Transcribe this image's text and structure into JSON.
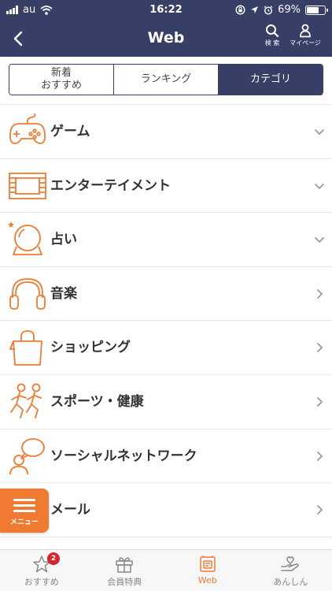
{
  "status_bar": {
    "carrier": "au",
    "time": "16:22",
    "battery": "69%",
    "battery_level": 0.69
  },
  "header": {
    "title": "Web",
    "search_label": "検 索",
    "mypage_label": "マイページ"
  },
  "segments": [
    {
      "label": "新着\nおすすめ",
      "active": false
    },
    {
      "label": "ランキング",
      "active": false
    },
    {
      "label": "カテゴリ",
      "active": true
    }
  ],
  "categories": [
    {
      "label": "ゲーム",
      "icon": "game-controller-icon",
      "chevron": "down"
    },
    {
      "label": "エンターテイメント",
      "icon": "film-strip-icon",
      "chevron": "down"
    },
    {
      "label": "占い",
      "icon": "crystal-ball-icon",
      "chevron": "down"
    },
    {
      "label": "音楽",
      "icon": "headphones-icon",
      "chevron": "right"
    },
    {
      "label": "ショッピング",
      "icon": "shopping-bag-icon",
      "chevron": "right"
    },
    {
      "label": "スポーツ・健康",
      "icon": "runners-icon",
      "chevron": "right"
    },
    {
      "label": "ソーシャルネットワーク",
      "icon": "social-chat-icon",
      "chevron": "right"
    },
    {
      "label": "メール",
      "icon": "mail-icon",
      "chevron": "right"
    }
  ],
  "menu_button": {
    "label": "メニュー"
  },
  "tabs": [
    {
      "label": "おすすめ",
      "icon": "star-icon",
      "badge": "2",
      "active": false
    },
    {
      "label": "会員特典",
      "icon": "gift-icon",
      "active": false
    },
    {
      "label": "Web",
      "icon": "web-icon",
      "active": true
    },
    {
      "label": "あんしん",
      "icon": "safety-hand-icon",
      "active": false
    }
  ],
  "colors": {
    "navy": "#373f66",
    "accent": "#f07a32",
    "badge": "#d7242a"
  }
}
